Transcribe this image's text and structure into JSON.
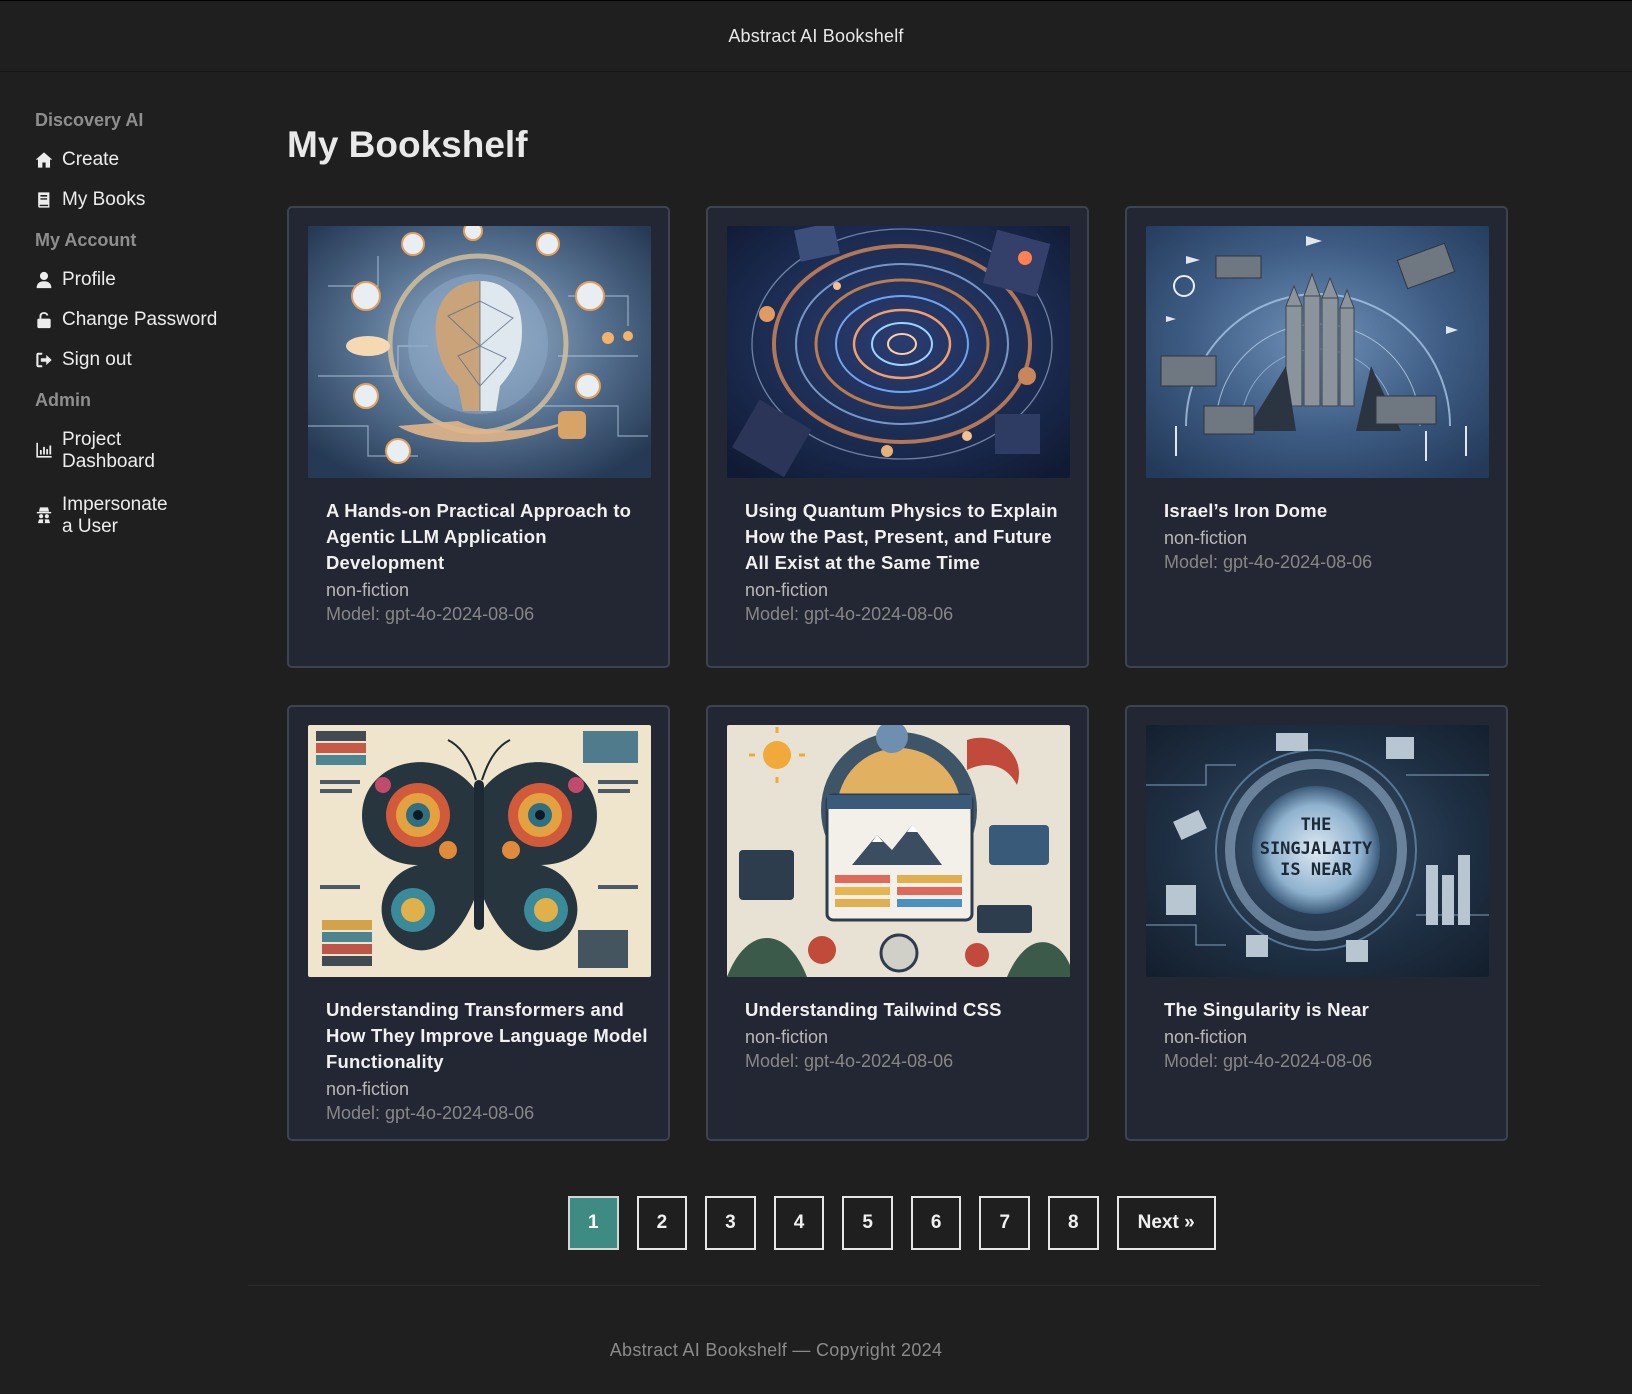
{
  "app": {
    "title": "Abstract AI Bookshelf"
  },
  "sidebar": {
    "sections": [
      {
        "label": "Discovery AI",
        "items": [
          {
            "label": "Create",
            "icon": "home-icon"
          },
          {
            "label": "My Books",
            "icon": "book-icon"
          }
        ]
      },
      {
        "label": "My Account",
        "items": [
          {
            "label": "Profile",
            "icon": "user-icon"
          },
          {
            "label": "Change Password",
            "icon": "lock-icon"
          },
          {
            "label": "Sign out",
            "icon": "sign-out-icon"
          }
        ]
      },
      {
        "label": "Admin",
        "items": [
          {
            "label": "Project Dashboard",
            "icon": "chart-icon"
          },
          {
            "label": "Impersonate a User",
            "icon": "incognito-icon"
          }
        ]
      }
    ]
  },
  "main": {
    "title": "My Bookshelf",
    "books": [
      {
        "title": "A Hands-on Practical Approach to Agentic LLM Application Development",
        "genre": "non-fiction",
        "model": "Model: gpt-4o-2024-08-06",
        "cover": "ai-head-cover"
      },
      {
        "title": "Using Quantum Physics to Explain How the Past, Present, and Future All Exist at the Same Time",
        "genre": "non-fiction",
        "model": "Model: gpt-4o-2024-08-06",
        "cover": "quantum-spiral-cover"
      },
      {
        "title": "Israel’s Iron Dome",
        "genre": "non-fiction",
        "model": "Model: gpt-4o-2024-08-06",
        "cover": "iron-dome-cover"
      },
      {
        "title": "Understanding Transformers and How They Improve Language Model Functionality",
        "genre": "non-fiction",
        "model": "Model: gpt-4o-2024-08-06",
        "cover": "butterfly-cover"
      },
      {
        "title": "Understanding Tailwind CSS",
        "genre": "non-fiction",
        "model": "Model: gpt-4o-2024-08-06",
        "cover": "tailwind-cover"
      },
      {
        "title": "The Singularity is Near",
        "genre": "non-fiction",
        "model": "Model: gpt-4o-2024-08-06",
        "cover": "singularity-cover",
        "cover_text": [
          "THE",
          "SINGJALAITY",
          "IS NEAR"
        ]
      }
    ]
  },
  "pagination": {
    "pages": [
      "1",
      "2",
      "3",
      "4",
      "5",
      "6",
      "7",
      "8"
    ],
    "active": "1",
    "next_label": "Next »"
  },
  "footer": {
    "text": "Abstract AI Bookshelf — Copyright 2024"
  },
  "colors": {
    "background": "#1f1f20",
    "card": "#222733",
    "accent": "#3d8b82"
  }
}
